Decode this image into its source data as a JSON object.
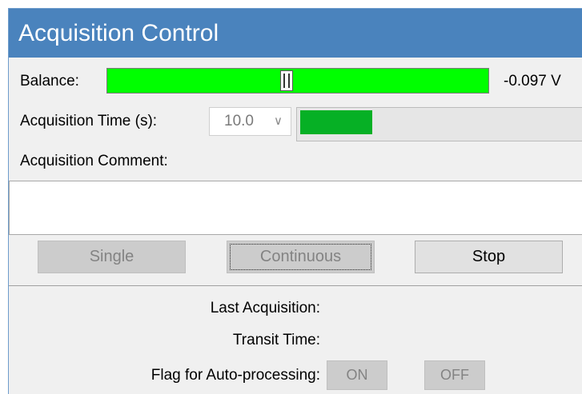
{
  "window": {
    "title": "Acquisition Control"
  },
  "balance": {
    "label": "Balance:",
    "value_text": "-0.097  V",
    "fill_color": "#00ff00",
    "slider_fraction": 0.47
  },
  "acq_time": {
    "label": "Acquisition Time (s):",
    "selected": "10.0",
    "progress_fraction": 0.26,
    "progress_color": "#06b025"
  },
  "comment": {
    "label": "Acquisition Comment:",
    "value": ""
  },
  "buttons": {
    "single": "Single",
    "continuous": "Continuous",
    "stop": "Stop"
  },
  "info": {
    "last_acquisition": "Last Acquisition:",
    "transit_time": "Transit Time:",
    "flag_label": "Flag for Auto-processing:",
    "on": "ON",
    "off": "OFF"
  }
}
